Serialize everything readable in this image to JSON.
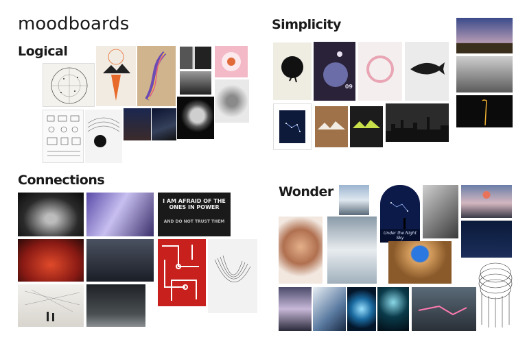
{
  "page": {
    "title": "moodboards"
  },
  "sections": {
    "logical": {
      "heading": "Logical"
    },
    "simplicity": {
      "heading": "Simplicity"
    },
    "connections": {
      "heading": "Connections"
    },
    "wonder": {
      "heading": "Wonder"
    }
  },
  "image_text": {
    "connections_quote": "I AM AFRAID OF THE ONES IN POWER",
    "connections_quote_2": "AND DO NOT TRUST THEM",
    "simplicity_poster_number": "09",
    "wonder_poster_caption": "Under the Night Sky"
  },
  "colors": {
    "accent_red": "#c8201c",
    "night_blue": "#0e1a3a",
    "poster_pink": "#e9a5b4",
    "mountain_green": "#c8e04a",
    "orange": "#e76a2a"
  }
}
